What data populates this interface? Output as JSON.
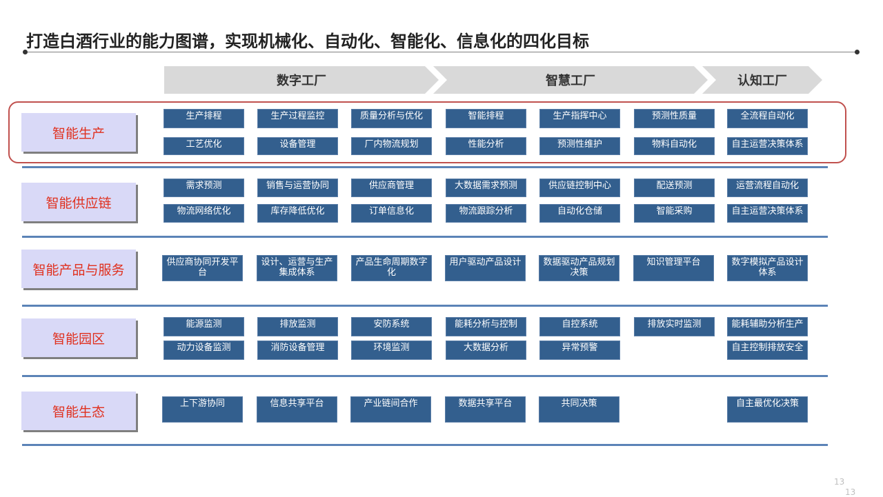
{
  "title": "打造白酒行业的能力图谱，实现机械化、自动化、智能化、信息化的四化目标",
  "phases": [
    "数字工厂",
    "智慧工厂",
    "认知工厂"
  ],
  "categories": [
    "智能生产",
    "智能供应链",
    "智能产品与服务",
    "智能园区",
    "智能生态"
  ],
  "cells": {
    "r1": [
      "生产排程",
      "生产过程监控",
      "质量分析与优化",
      "智能排程",
      "生产指挥中心",
      "预测性质量",
      "全流程自动化"
    ],
    "r2": [
      "工艺优化",
      "设备管理",
      "厂内物流规划",
      "性能分析",
      "预测性维护",
      "物料自动化",
      "自主运营决策体系"
    ],
    "r3": [
      "需求预测",
      "销售与运营协同",
      "供应商管理",
      "大数据需求预测",
      "供应链控制中心",
      "配送预测",
      "运营流程自动化"
    ],
    "r4": [
      "物流网络优化",
      "库存降低优化",
      "订单信息化",
      "物流跟踪分析",
      "自动化仓储",
      "智能采购",
      "自主运营决策体系"
    ],
    "r5": [
      "供应商协同开发平台",
      "设计、运营与生产集成体系",
      "产品生命周期数字化",
      "用户驱动产品设计",
      "数据驱动产品规划决策",
      "知识管理平台",
      "数字模拟产品设计体系"
    ],
    "r6": [
      "能源监测",
      "排放监测",
      "安防系统",
      "能耗分析与控制",
      "自控系统",
      "排放实时监测",
      "能耗辅助分析生产"
    ],
    "r7": [
      "动力设备监测",
      "消防设备管理",
      "环境监测",
      "大数据分析",
      "异常预警",
      "自主控制排放安全"
    ],
    "r8": [
      "上下游协同",
      "信息共享平台",
      "产业链间合作",
      "数据共享平台",
      "共同决策",
      "自主最优化决策"
    ]
  },
  "page_number": "13",
  "page_number_2": "13"
}
